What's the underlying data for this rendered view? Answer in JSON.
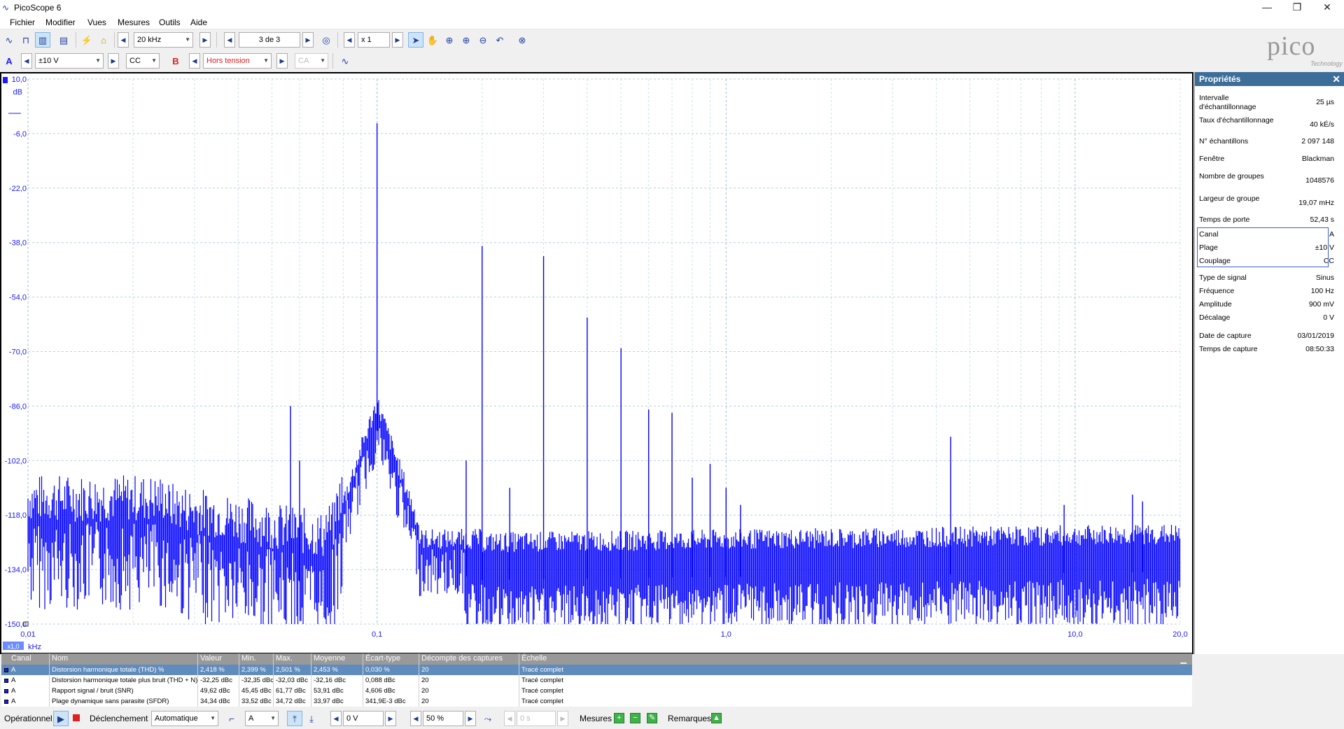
{
  "app": {
    "title": "PicoScope 6"
  },
  "menu": [
    "Fichier",
    "Modifier",
    "Vues",
    "Mesures",
    "Outils",
    "Aide"
  ],
  "toolbar": {
    "timebase": "20 kHz",
    "capture_index": "3 de 3",
    "zoom": "x 1",
    "channel_a_label": "A",
    "channel_a_range": "±10 V",
    "channel_a_coupling": "CC",
    "channel_b_label": "B",
    "channel_b_range": "Hors tension",
    "channel_b_coupling": "CA"
  },
  "chart_data": {
    "type": "line",
    "title": "",
    "xlabel": "kHz",
    "ylabel": "dB",
    "x_scale": "log",
    "xlim": [
      0.01,
      20.0
    ],
    "ylim": [
      -150.0,
      10.0
    ],
    "x_ticks": [
      "0,01",
      "0,1",
      "1,0",
      "10,0",
      "20,0"
    ],
    "y_ticks": [
      "10,0",
      "-6,0",
      "-22,0",
      "-38,0",
      "-54,0",
      "-70,0",
      "-86,0",
      "-102,0",
      "-118,0",
      "-134,0",
      "-150,0"
    ],
    "x_scale_badge": "x1,0",
    "series": [
      {
        "color": "#0000ff",
        "peaks_khz": [
          0.0565,
          0.06,
          0.1,
          0.18,
          0.2,
          0.24,
          0.3,
          0.4,
          0.5,
          0.6,
          0.7,
          0.8,
          0.9,
          1.0,
          1.1,
          4.4,
          9.3,
          14.6,
          15.6
        ],
        "peaks_db": [
          -86,
          -102,
          -3,
          -102,
          -39,
          -110,
          -42,
          -60,
          -69,
          -87,
          -88,
          -107,
          -103,
          -110,
          -115,
          -95,
          -115,
          -112,
          -114
        ]
      }
    ]
  },
  "properties": {
    "title": "Propriétés",
    "group1": [
      {
        "label": "Intervalle d'échantillonnage",
        "value": "25 µs"
      },
      {
        "label": "Taux d'échantillonnage",
        "value": "40 kÉ/s"
      },
      {
        "label": "N° échantillons",
        "value": "2 097 148"
      },
      {
        "label": "Fenêtre",
        "value": "Blackman"
      },
      {
        "label": "Nombre de groupes",
        "value": "1048576"
      },
      {
        "label": "Largeur de groupe",
        "value": "19,07 mHz"
      },
      {
        "label": "Temps de porte",
        "value": "52,43 s"
      }
    ],
    "channel": [
      {
        "label": "Canal",
        "value": "A"
      },
      {
        "label": "Plage",
        "value": "±10 V"
      },
      {
        "label": "Couplage",
        "value": "CC"
      }
    ],
    "group2": [
      {
        "label": "Type de signal",
        "value": "Sinus"
      },
      {
        "label": "Fréquence",
        "value": "100 Hz"
      },
      {
        "label": "Amplitude",
        "value": "900 mV"
      },
      {
        "label": "Décalage",
        "value": "0 V"
      }
    ],
    "group3": [
      {
        "label": "Date de capture",
        "value": "03/01/2019"
      },
      {
        "label": "Temps de capture",
        "value": "08:50:33"
      }
    ]
  },
  "measurements": {
    "headers": [
      "Canal",
      "Nom",
      "Valeur",
      "Min.",
      "Max.",
      "Moyenne",
      "Écart-type",
      "Décompte des captures",
      "Échelle"
    ],
    "rows": [
      [
        "A",
        "Distorsion harmonique totale (THD) %",
        "2,418 %",
        "2,399 %",
        "2,501 %",
        "2,453 %",
        "0,030 %",
        "20",
        "Tracé complet"
      ],
      [
        "A",
        "Distorsion harmonique totale plus bruit (THD + N)",
        "-32,25 dBc",
        "-32,35 dBc",
        "-32,03 dBc",
        "-32,16 dBc",
        "0,088 dBc",
        "20",
        "Tracé complet"
      ],
      [
        "A",
        "Rapport signal / bruit (SNR)",
        "49,62 dBc",
        "45,45 dBc",
        "61,77 dBc",
        "53,91 dBc",
        "4,606 dBc",
        "20",
        "Tracé complet"
      ],
      [
        "A",
        "Plage dynamique sans parasite (SFDR)",
        "34,34 dBc",
        "33,52 dBc",
        "34,72 dBc",
        "33,97 dBc",
        "341,9E-3 dBc",
        "20",
        "Tracé complet"
      ]
    ]
  },
  "statusbar": {
    "status": "Opérationnel",
    "trigger_label": "Déclenchement",
    "trigger_mode": "Automatique",
    "trigger_source": "A",
    "trigger_level": "0 V",
    "pretrigger": "50 %",
    "delay": "0 s",
    "measurements_label": "Mesures",
    "notes_label": "Remarques"
  },
  "logo": {
    "text": "pico",
    "sub": "Technology"
  },
  "colors": {
    "trace": "#0000ff",
    "panel_header": "#3c6e99",
    "table_header": "#999999",
    "selected_row": "#5f8bbd"
  }
}
